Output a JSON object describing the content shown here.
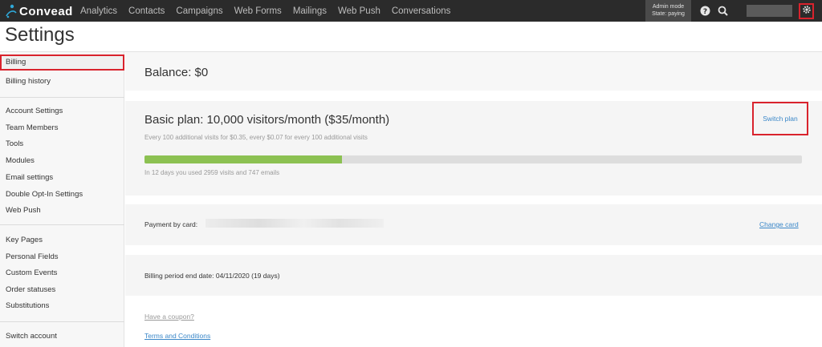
{
  "app": {
    "logo_text": "Convead",
    "brand_color": "#2fa8d8",
    "nav_items": [
      "Analytics",
      "Contacts",
      "Campaigns",
      "Web Forms",
      "Mailings",
      "Web Push",
      "Conversations"
    ],
    "admin_mode": "Admin mode",
    "admin_state": "State: paying",
    "icons": [
      "help-icon",
      "search-icon",
      "gear-icon"
    ]
  },
  "page": {
    "title": "Settings"
  },
  "sidebar": {
    "items": [
      "Billing",
      "Billing history",
      "Account Settings",
      "Team Members",
      "Tools",
      "Modules",
      "Email settings",
      "Double Opt-In Settings",
      "Web Push",
      "Key Pages",
      "Personal Fields",
      "Custom Events",
      "Order statuses",
      "Substitutions",
      "Switch account"
    ],
    "active": "Billing"
  },
  "billing": {
    "balance": "Balance: $0",
    "plan_title": "Basic plan: 10,000 visitors/month ($35/month)",
    "plan_subtitle": "Every 100 additional visits for $0.35, every $0.07 for every 100 additional visits",
    "switch_plan": "Switch plan",
    "usage_fraction": 0.3,
    "usage_text": "In 12 days you used 2959 visits and 747 emails",
    "payment_label": "Payment by card:",
    "change_card": "Change card",
    "period_end": "Billing period end date: 04/11/2020 (19 days)",
    "coupon_link": "Have a coupon?",
    "terms_link": "Terms and Conditions"
  },
  "colors": {
    "accent_link": "#3a87c8",
    "progress_fill": "#8cc152",
    "highlight": "#d9232d"
  }
}
